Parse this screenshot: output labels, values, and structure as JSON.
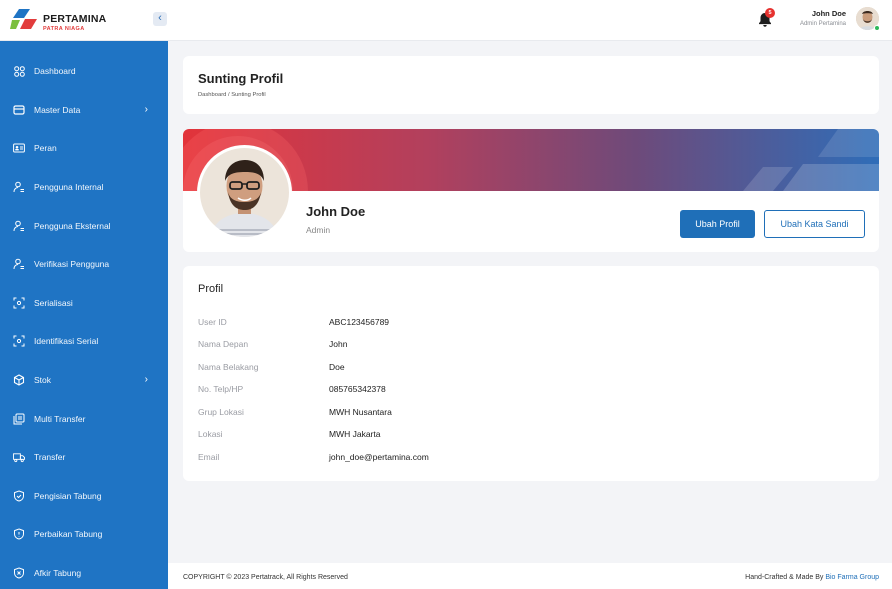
{
  "brand": {
    "name": "PERTAMINA",
    "sub": "PATRA NIAGA"
  },
  "header": {
    "notification_count": "5",
    "user_name": "John Doe",
    "user_role": "Admin Pertamina"
  },
  "sidebar": {
    "items": [
      {
        "label": "Dashboard",
        "icon": "grid-icon"
      },
      {
        "label": "Master Data",
        "icon": "database-icon",
        "chevron": "›"
      },
      {
        "label": "Peran",
        "icon": "id-card-icon"
      },
      {
        "label": "Pengguna Internal",
        "icon": "user-icon"
      },
      {
        "label": "Pengguna Eksternal",
        "icon": "user-icon"
      },
      {
        "label": "Verifikasi Pengguna",
        "icon": "user-icon"
      },
      {
        "label": "Serialisasi",
        "icon": "scan-icon"
      },
      {
        "label": "Identifikasi Serial",
        "icon": "scan-icon"
      },
      {
        "label": "Stok",
        "icon": "box-icon",
        "chevron": "›"
      },
      {
        "label": "Multi Transfer",
        "icon": "copy-icon"
      },
      {
        "label": "Transfer",
        "icon": "truck-icon"
      },
      {
        "label": "Pengisian Tabung",
        "icon": "shield-check-icon"
      },
      {
        "label": "Perbaikan Tabung",
        "icon": "shield-alert-icon"
      },
      {
        "label": "Afkir Tabung",
        "icon": "shield-x-icon"
      }
    ]
  },
  "page": {
    "title": "Sunting Profil",
    "breadcrumb": "Dashboard / Sunting Profil"
  },
  "profile": {
    "name": "John Doe",
    "role": "Admin",
    "edit_label": "Ubah Profil",
    "password_label": "Ubah Kata Sandi"
  },
  "info": {
    "title": "Profil",
    "fields": [
      {
        "label": "User ID",
        "value": "ABC123456789"
      },
      {
        "label": "Nama Depan",
        "value": "John"
      },
      {
        "label": "Nama Belakang",
        "value": "Doe"
      },
      {
        "label": "No. Telp/HP",
        "value": "085765342378"
      },
      {
        "label": "Grup Lokasi",
        "value": "MWH Nusantara"
      },
      {
        "label": "Lokasi",
        "value": "MWH Jakarta"
      },
      {
        "label": "Email",
        "value": "john_doe@pertamina.com"
      }
    ]
  },
  "footer": {
    "copyright": "COPYRIGHT © 2023 Pertatrack, All Rights Reserved",
    "credit_prefix": "Hand-Crafted & Made By ",
    "credit_link": "Bio Farma Group"
  },
  "colors": {
    "sidebar": "#1f74c4",
    "primary": "#1f6fb8",
    "banner_start": "#e2333a",
    "banner_end": "#2f6db8",
    "badge": "#e6322f"
  }
}
